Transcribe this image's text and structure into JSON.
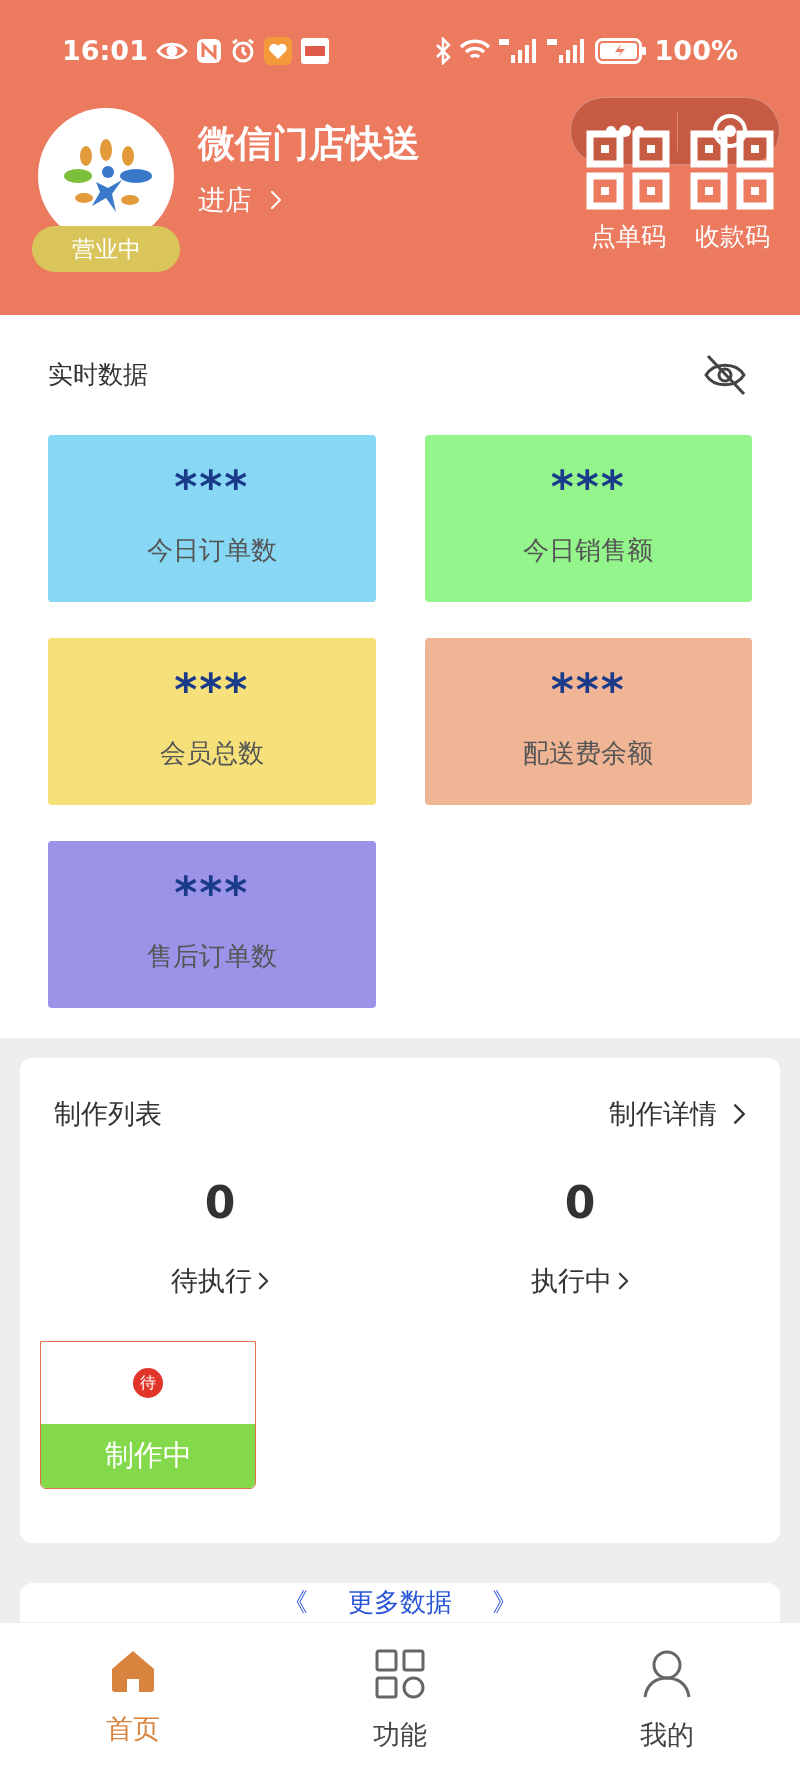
{
  "status_bar": {
    "time": "16:01",
    "battery": "100%"
  },
  "store": {
    "name": "微信门店快送",
    "link": "进店",
    "status_badge": "营业中"
  },
  "qr_buttons": [
    {
      "label": "点单码"
    },
    {
      "label": "收款码"
    }
  ],
  "realtime": {
    "title": "实时数据",
    "cards": [
      {
        "value": "***",
        "label": "今日订单数",
        "color": "#87d7f5"
      },
      {
        "value": "***",
        "label": "今日销售额",
        "color": "#94f58c"
      },
      {
        "value": "***",
        "label": "会员总数",
        "color": "#f5e07a"
      },
      {
        "value": "***",
        "label": "配送费余额",
        "color": "#f0b595"
      },
      {
        "value": "***",
        "label": "售后订单数",
        "color": "#9b93e8"
      }
    ]
  },
  "production": {
    "title": "制作列表",
    "detail_link": "制作详情",
    "counts": [
      {
        "value": "0",
        "label": "待执行"
      },
      {
        "value": "0",
        "label": "执行中"
      }
    ],
    "items": [
      {
        "badge": "待",
        "label": "制作中"
      }
    ]
  },
  "more_data": {
    "left": "《",
    "label": "更多数据",
    "right": "》"
  },
  "nav": [
    {
      "label": "首页",
      "selected": true
    },
    {
      "label": "功能",
      "selected": false
    },
    {
      "label": "我的",
      "selected": false
    }
  ]
}
